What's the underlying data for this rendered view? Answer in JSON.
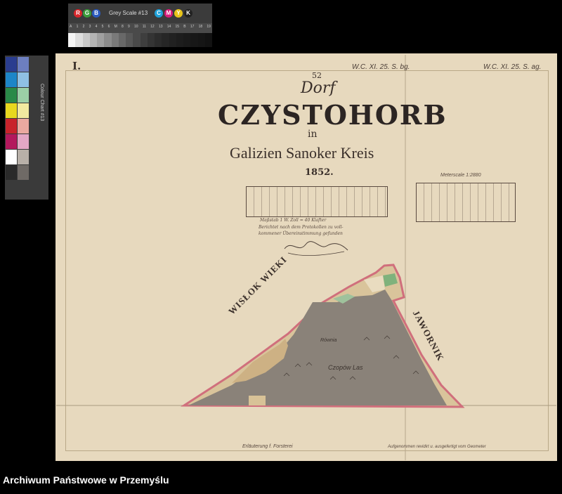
{
  "greyscale_card": {
    "letters": [
      "R",
      "G",
      "B",
      "C",
      "M",
      "Y",
      "K"
    ],
    "letter_colors": [
      "#d8262b",
      "#3a9b3a",
      "#2b5bbf",
      "#1ea0d8",
      "#d81c7c",
      "#e8c41a",
      "#222222"
    ],
    "title": "Grey Scale #13",
    "ticks": [
      "A",
      "1",
      "2",
      "3",
      "4",
      "5",
      "6",
      "M",
      "8",
      "9",
      "10",
      "11",
      "12",
      "13",
      "14",
      "15",
      "B",
      "17",
      "18",
      "19"
    ],
    "shades": [
      "#f4f4f4",
      "#dedede",
      "#c9c9c9",
      "#b4b4b4",
      "#a0a0a0",
      "#8c8c8c",
      "#7a7a7a",
      "#686868",
      "#585858",
      "#4a4a4a",
      "#3e3e3e",
      "#343434",
      "#2c2c2c",
      "#262626",
      "#212121",
      "#1d1d1d",
      "#1a1a1a",
      "#171717",
      "#151515",
      "#121212"
    ]
  },
  "colour_card": {
    "title": "Colour Chart #13",
    "swatches": [
      "#2a3d8f",
      "#6d7fc0",
      "#1d85c8",
      "#8fc0e4",
      "#2a8a48",
      "#9bcfa6",
      "#e8d81e",
      "#f2eaa0",
      "#c8232b",
      "#eaa9a0",
      "#b3185d",
      "#e3a7c5",
      "#ffffff",
      "#b8b0a8",
      "#2a2a2a",
      "#6f6a66"
    ]
  },
  "map": {
    "sheet_number": "I.",
    "ref_left": "W.C. XI. 25. S. bg.",
    "ref_right": "W.C. XI. 25. S. ag.",
    "number": "52",
    "dorf": "Dorf",
    "village": "CZYSTOHORB",
    "in": "in",
    "region": "Galizien Sanoker Kreis",
    "year": "1852.",
    "scale2_caption": "Meterscale 1:2880",
    "note_lines": [
      "Maßstab 1 W. Zoll = 40 Klafter",
      "Berichtet nach dem Protokollen zu voll-",
      "kommener Übereinstimmung gefunden"
    ],
    "neighbour_left": "WISŁOK WIEKI",
    "neighbour_right": "JAWORNIK",
    "label_rownia": "Równia",
    "label_forest": "Czopów Las",
    "foot_left": "Erläuterung f. Forsterei",
    "foot_right": "Aufgenommen revidirt u. ausgefertigt vom Geometer"
  },
  "archive_label": "Archiwum Państwowe w Przemyślu"
}
